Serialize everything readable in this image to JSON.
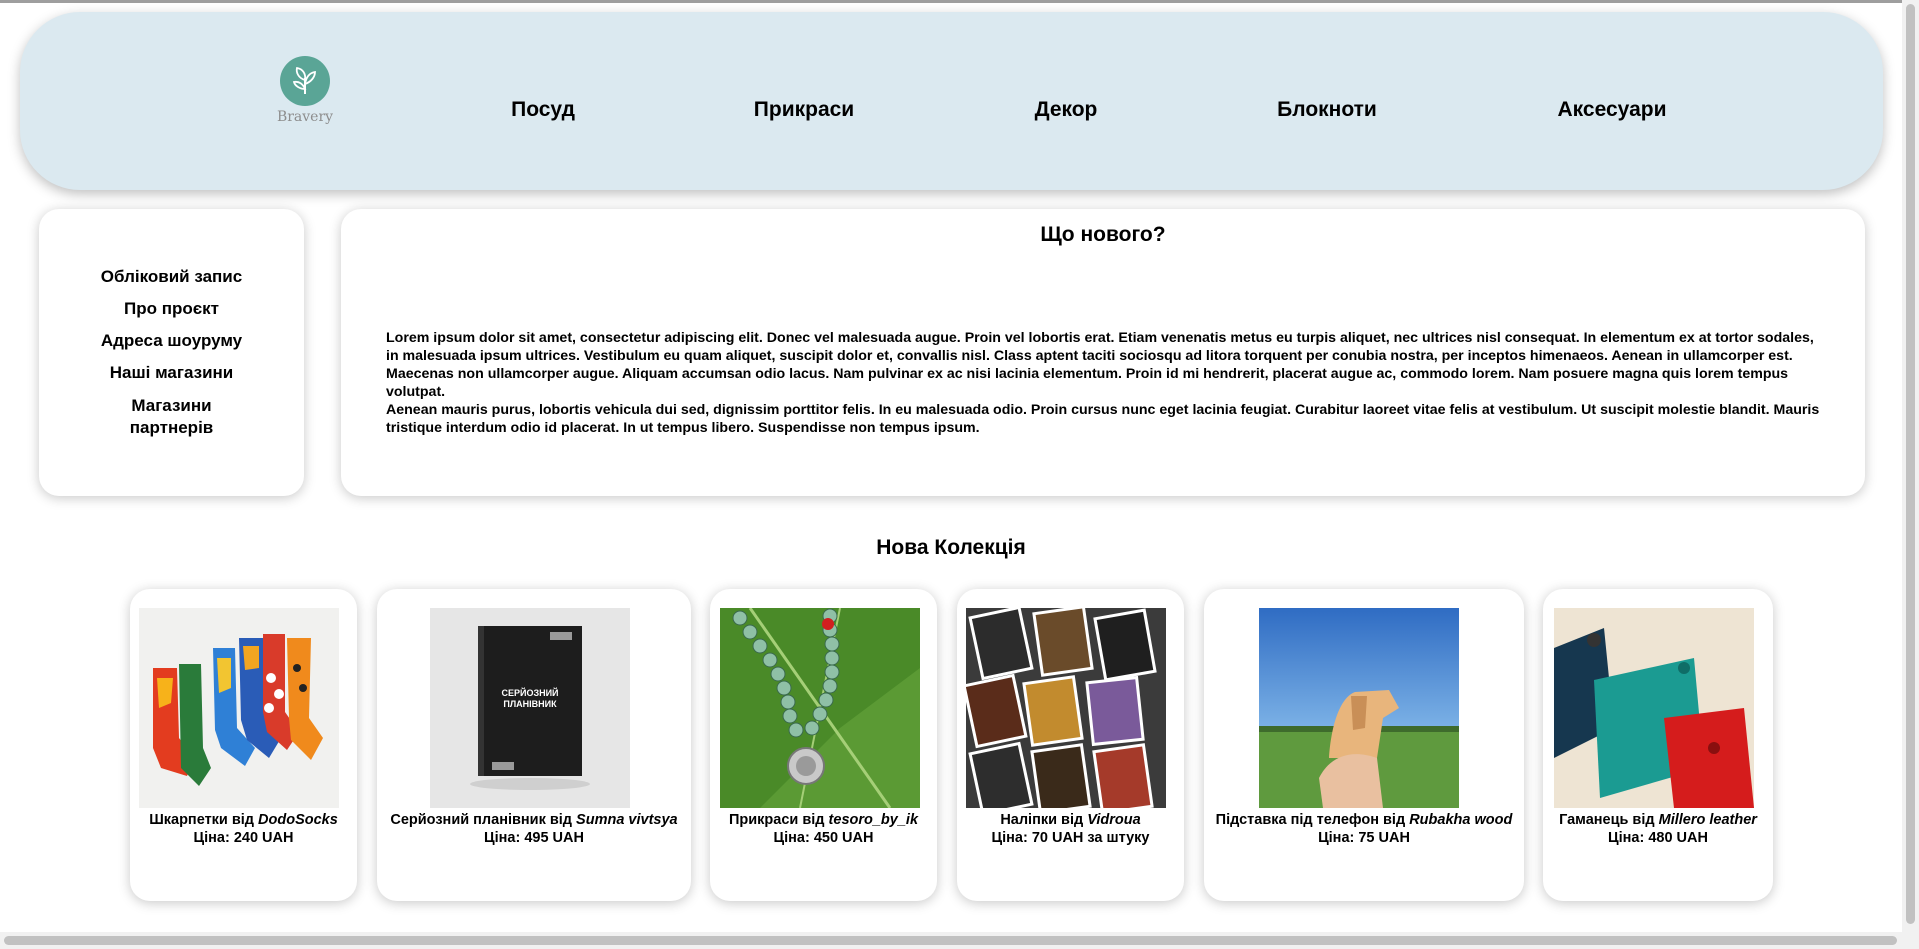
{
  "header": {
    "brand": "Bravery",
    "nav": [
      "Посуд",
      "Прикраси",
      "Декор",
      "Блокноти",
      "Аксесуари"
    ]
  },
  "sidebar": {
    "links": [
      "Обліковий запис",
      "Про проєкт",
      "Адреса шоуруму",
      "Наші магазини",
      "Магазини партнерів"
    ]
  },
  "news": {
    "title": "Що нового?",
    "paragraph1": "Lorem ipsum dolor sit amet, consectetur adipiscing elit. Donec vel malesuada augue. Proin vel lobortis erat. Etiam venenatis metus eu turpis aliquet, nec ultrices nisl consequat. In elementum ex at tortor sodales, in malesuada ipsum ultrices. Vestibulum eu quam aliquet, suscipit dolor et, convallis nisl. Class aptent taciti sociosqu ad litora torquent per conubia nostra, per inceptos himenaeos. Aenean in ullamcorper est. Maecenas non ullamcorper augue. Aliquam accumsan odio lacus. Nam pulvinar ex ac nisi lacinia elementum. Proin id mi hendrerit, placerat augue ac, commodo lorem. Nam posuere magna quis lorem tempus volutpat.",
    "paragraph2": "Aenean mauris purus, lobortis vehicula dui sed, dignissim porttitor felis. In eu malesuada odio. Proin cursus nunc eget lacinia feugiat. Curabitur laoreet vitae felis at vestibulum. Ut suscipit molestie blandit. Mauris tristique interdum odio id placerat. In ut tempus libero. Suspendisse non tempus ipsum."
  },
  "collection": {
    "title": "Нова Колекція",
    "products": [
      {
        "name": "Шкарпетки від",
        "brand": "DodoSocks",
        "price": "Ціна: 240 UAH"
      },
      {
        "name": "Серйозний планівник від",
        "brand": "Sumna vivtsya",
        "price": "Ціна: 495 UAH",
        "book_title": "СЕРЙОЗНИЙ ПЛАНІВНИК"
      },
      {
        "name": "Прикраси від",
        "brand": "tesoro_by_ik",
        "price": "Ціна: 450 UAH"
      },
      {
        "name": "Наліпки від",
        "brand": "Vidroua",
        "price": "Ціна: 70 UAH за штуку"
      },
      {
        "name": "Підставка під телефон від",
        "brand": "Rubakha wood",
        "price": "Ціна: 75 UAH"
      },
      {
        "name": "Гаманець від",
        "brand": "Millero leather",
        "price": "Ціна: 480 UAH"
      }
    ]
  },
  "colors": {
    "header_bg": "#dbe9f0",
    "logo": "#5aa596"
  }
}
